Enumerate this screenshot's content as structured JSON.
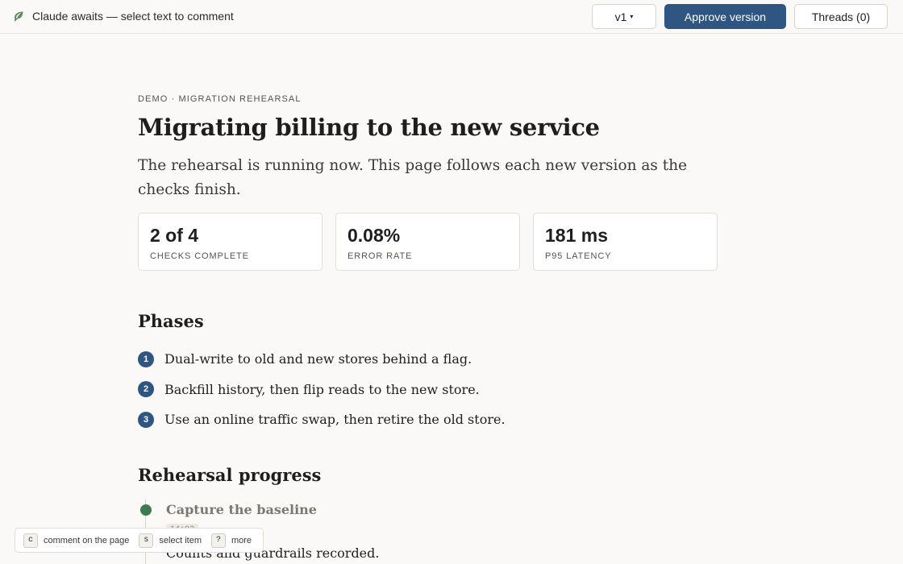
{
  "topbar": {
    "status": "Claude awaits — select text to comment",
    "icon": "leaf-icon",
    "version_label": "v1",
    "version_caret": "▾",
    "approve_label": "Approve version",
    "threads_label": "Threads (0)"
  },
  "page": {
    "eyebrow": "DEMO · MIGRATION REHEARSAL",
    "title": "Migrating billing to the new service",
    "lede": "The rehearsal is running now. This page follows each new version as the checks finish."
  },
  "stats": [
    {
      "value": "2 of 4",
      "label": "CHECKS COMPLETE"
    },
    {
      "value": "0.08%",
      "label": "ERROR RATE"
    },
    {
      "value": "181 ms",
      "label": "P95 LATENCY"
    }
  ],
  "phases": {
    "heading": "Phases",
    "items": [
      {
        "num": "1",
        "text": "Dual-write to old and new stores behind a flag."
      },
      {
        "num": "2",
        "text": "Backfill history, then flip reads to the new store."
      },
      {
        "num": "3",
        "text": "Use an online traffic swap, then retire the old store."
      }
    ]
  },
  "progress": {
    "heading": "Rehearsal progress",
    "steps": [
      {
        "title": "Capture the baseline",
        "time": "14:02",
        "desc": "Counts and guardrails recorded.",
        "status_color": "#3e7a4f"
      }
    ]
  },
  "hints": [
    {
      "key": "c",
      "label": "comment on the page"
    },
    {
      "key": "s",
      "label": "select item"
    },
    {
      "key": "?",
      "label": "more"
    }
  ],
  "colors": {
    "accent": "#2f5583",
    "success": "#3e7a4f",
    "background": "#faf9f7"
  }
}
